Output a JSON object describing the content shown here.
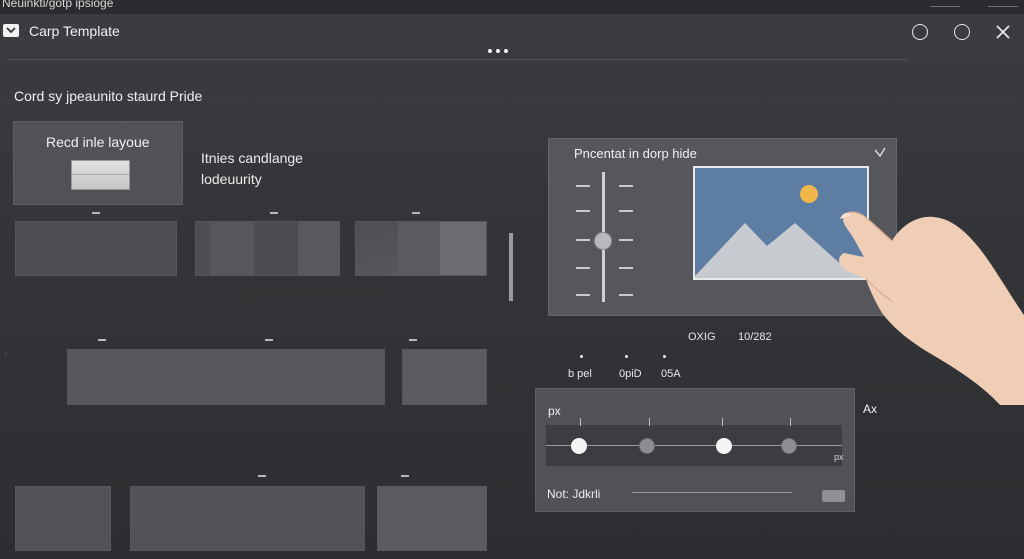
{
  "top_strip": {
    "text": "Neuinkti/gotp ipsioge"
  },
  "window": {
    "title": "Carp Template",
    "icons": {
      "app": "dropdown-chevron-icon",
      "minimize": "circle-icon",
      "maximize": "circle-icon",
      "close": "close-icon",
      "more": "more-dots-icon"
    }
  },
  "main": {
    "heading": "Cord sy jpeaunito staurd Pride",
    "card": {
      "title": "Recd inle layoue"
    },
    "card_description": {
      "line1": "Itnies candlange",
      "line2": "lodeuurity"
    }
  },
  "image_dialog": {
    "title": "Pncentat in dorp hide",
    "vertical_slider_level": 0.5,
    "picture": {
      "sky_color": "#5e7da3",
      "sun_color": "#f0b84a",
      "mountain_color": "#c7cbd0",
      "icon": "image-placeholder-icon"
    }
  },
  "meta": {
    "oxg": "OXIG",
    "ratio": "10/282"
  },
  "bullets": [
    {
      "label": "b pel"
    },
    {
      "label": "0piD"
    },
    {
      "label": "05A"
    }
  ],
  "slider_dialog": {
    "label": "px",
    "unit": "px",
    "footer_label": "Not: Jdkrli",
    "side_label": "Ax",
    "knobs": [
      {
        "style": "white",
        "fraction": 0.11
      },
      {
        "style": "gray",
        "fraction": 0.34
      },
      {
        "style": "white",
        "fraction": 0.6
      },
      {
        "style": "gray",
        "fraction": 0.82
      }
    ]
  },
  "colors": {
    "background": "#333538",
    "dialog": "#55575b",
    "accent_white": "#f5f5f5"
  }
}
